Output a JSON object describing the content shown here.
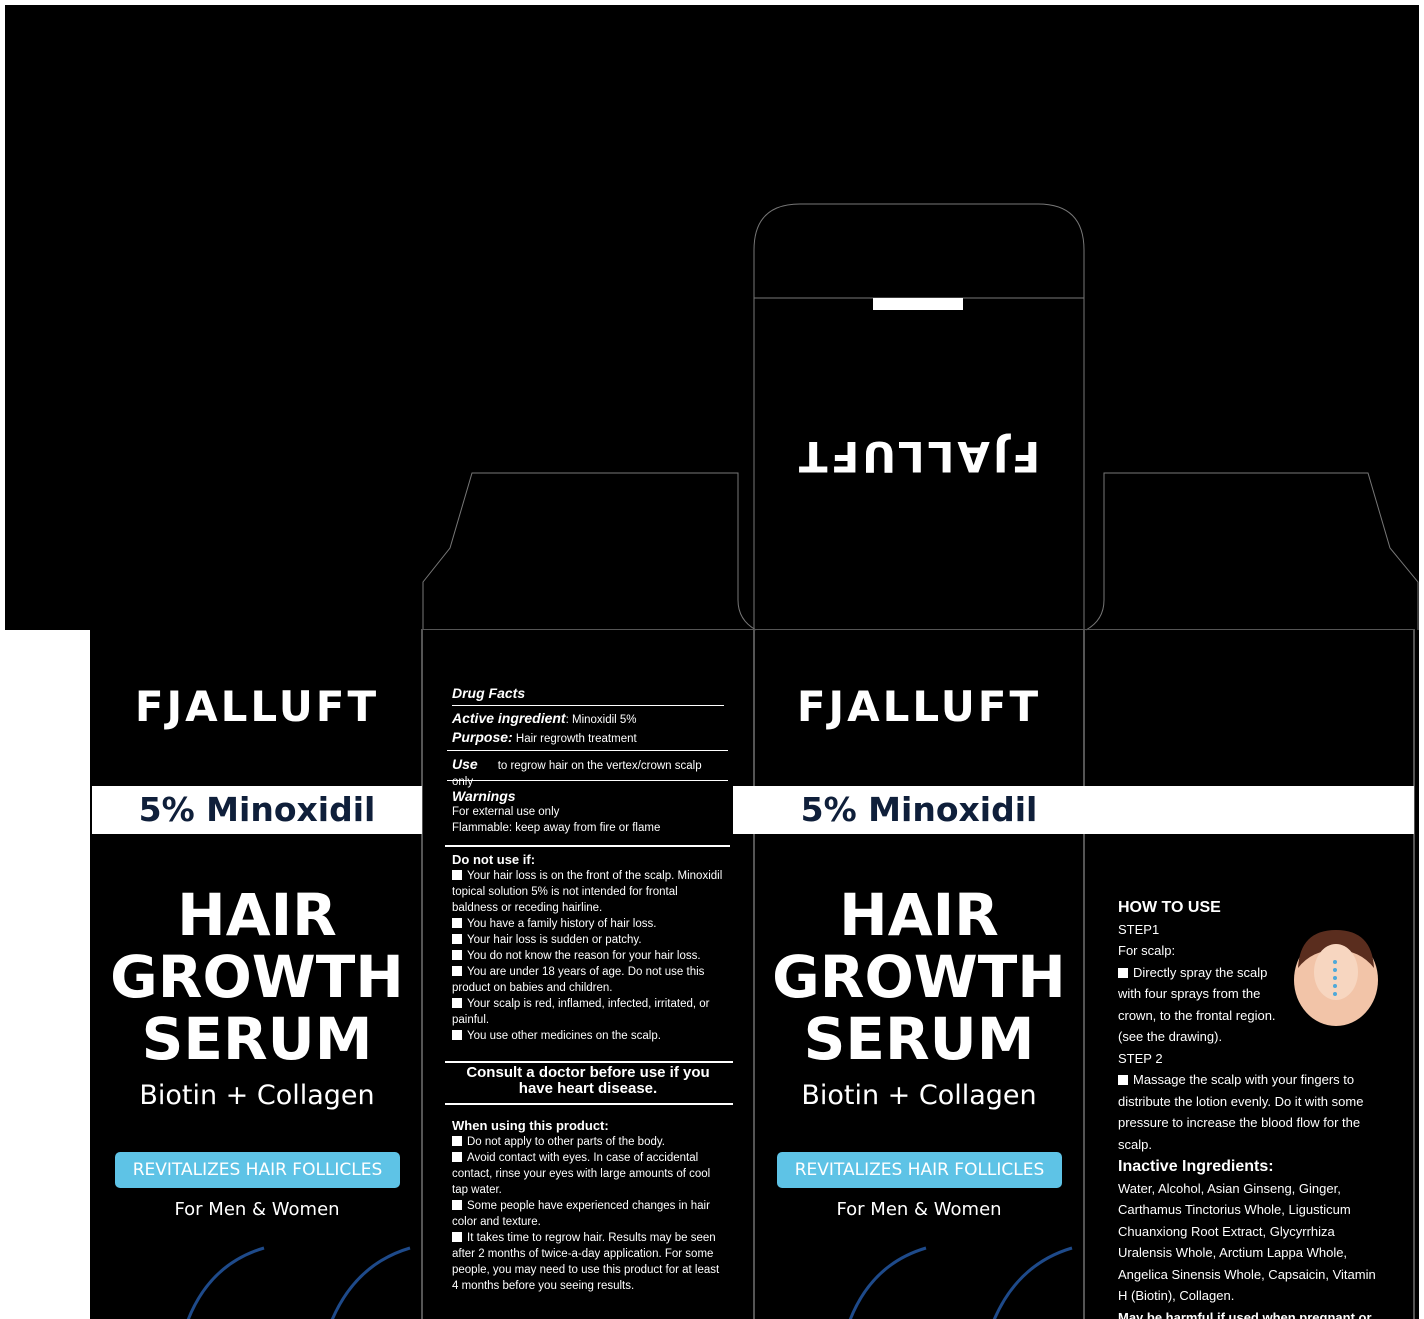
{
  "brand": {
    "logo": "FJALLUFT",
    "logo_flipped": "FJALLUFT"
  },
  "front": {
    "strength": "5% Minoxidil",
    "title_line1": "HAIR",
    "title_line2": "GROWTH",
    "title_line3": "SERUM",
    "subtitle": "Biotin + Collagen",
    "badge": "REVITALIZES HAIR FOLLICLES",
    "audience": "For Men & Women"
  },
  "drug_facts": {
    "header": "Drug Facts",
    "active_label": "Active ingredient",
    "active_value": ": Minoxidil 5%",
    "purpose_label": "Purpose:",
    "purpose_value": " Hair regrowth treatment",
    "use_label": "Use",
    "use_value": "to regrow hair on the vertex/crown scalp  only",
    "warnings_label": "Warnings",
    "warnings_1": "For external use only",
    "warnings_2": "Flammable: keep away from fire or flame",
    "donot_label": "Do not use if:",
    "donot_items": [
      "Your hair loss is on the front of the scalp. Minoxidil topical solution 5% is not intended for frontal baldness or receding hairline.",
      "You have a family history of hair loss.",
      "Your hair loss is sudden or patchy.",
      "You do not know the reason for your hair loss.",
      "You are under 18 years of age. Do not use this product on babies and children.",
      "Your scalp is red, inflamed, infected, irritated, or painful.",
      "You use other medicines on the scalp."
    ],
    "consult": "Consult a doctor before use if you have heart disease.",
    "when_label": "When using this product:",
    "when_items": [
      "Do not apply to other parts of the body.",
      "Avoid contact with  eyes. In case of accidental contact, rinse your eyes with large amounts of cool tap water.",
      "Some people have experienced changes in hair color and texture.",
      "It takes time to regrow hair. Results may be seen after  2 months of twice-a-day application. For some people, you may need to use this product for at least 4 months before you seeing results."
    ]
  },
  "how_to_use": {
    "title": "HOW TO USE",
    "step1": "STEP1",
    "for_scalp": "For scalp:",
    "step1_text": "Directly spray the scalp with four sprays from the crown, to the frontal region. (see the drawing).",
    "step2": "STEP 2",
    "step2_text": "Massage the scalp with your fingers to distribute the lotion evenly. Do it with some pressure to increase the blood flow for the scalp.",
    "inactive_label": "Inactive Ingredients:",
    "inactive_text": "Water, Alcohol, Asian Ginseng, Ginger, Carthamus Tinctorius Whole, Ligusticum Chuanxiong Root Extract, Glycyrrhiza Uralensis Whole,  Arctium Lappa Whole, Angelica Sinensis Whole, Capsaicin, Vitamin H (Biotin), Collagen.",
    "pregnancy_partial": "May be harmful if used when pregnant or"
  },
  "colors": {
    "background": "#000000",
    "band": "#ffffff",
    "navy_text": "#0f1f3a",
    "badge": "#5ec3e6",
    "swoosh": "#1e4a8a"
  }
}
